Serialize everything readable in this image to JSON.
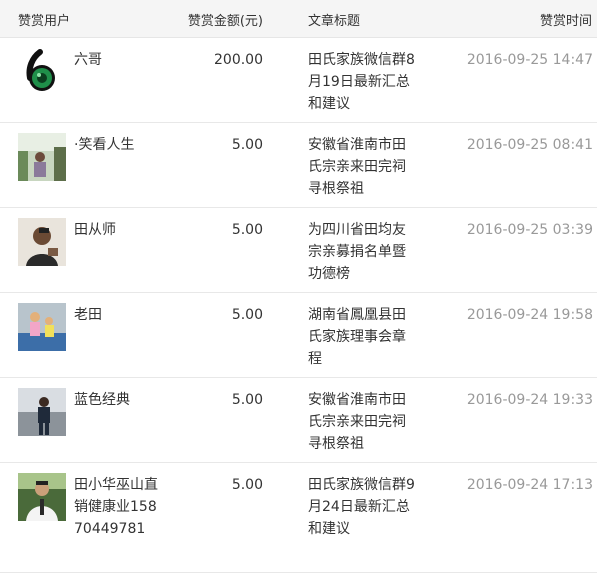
{
  "header": {
    "user": "赞赏用户",
    "amount": "赞赏金额(元)",
    "title": "文章标题",
    "time": "赞赏时间"
  },
  "rows": [
    {
      "user": "六哥",
      "amount": "200.00",
      "title": "田氏家族微信群8月19日最新汇总和建议",
      "time": "2016-09-25 14:47",
      "avatar": "avatar-green-six-logo"
    },
    {
      "user": "·笑看人生",
      "amount": "5.00",
      "title": "安徽省淮南市田氏宗亲来田完祠寻根祭祖",
      "time": "2016-09-25 08:41",
      "avatar": "avatar-person-photo"
    },
    {
      "user": "田从师",
      "amount": "5.00",
      "title": "为四川省田均友宗亲募捐名单暨功德榜",
      "time": "2016-09-25 03:39",
      "avatar": "avatar-person-photo"
    },
    {
      "user": "老田",
      "amount": "5.00",
      "title": "湖南省鳳凰县田氏家族理事会章程",
      "time": "2016-09-24 19:58",
      "avatar": "avatar-children-photo"
    },
    {
      "user": "蓝色经典",
      "amount": "5.00",
      "title": "安徽省淮南市田氏宗亲来田完祠寻根祭祖",
      "time": "2016-09-24 19:33",
      "avatar": "avatar-person-photo"
    },
    {
      "user": "田小华巫山直销健康业15870449781",
      "amount": "5.00",
      "title": "田氏家族微信群9月24日最新汇总和建议",
      "time": "2016-09-24 17:13",
      "avatar": "avatar-person-photo"
    }
  ]
}
